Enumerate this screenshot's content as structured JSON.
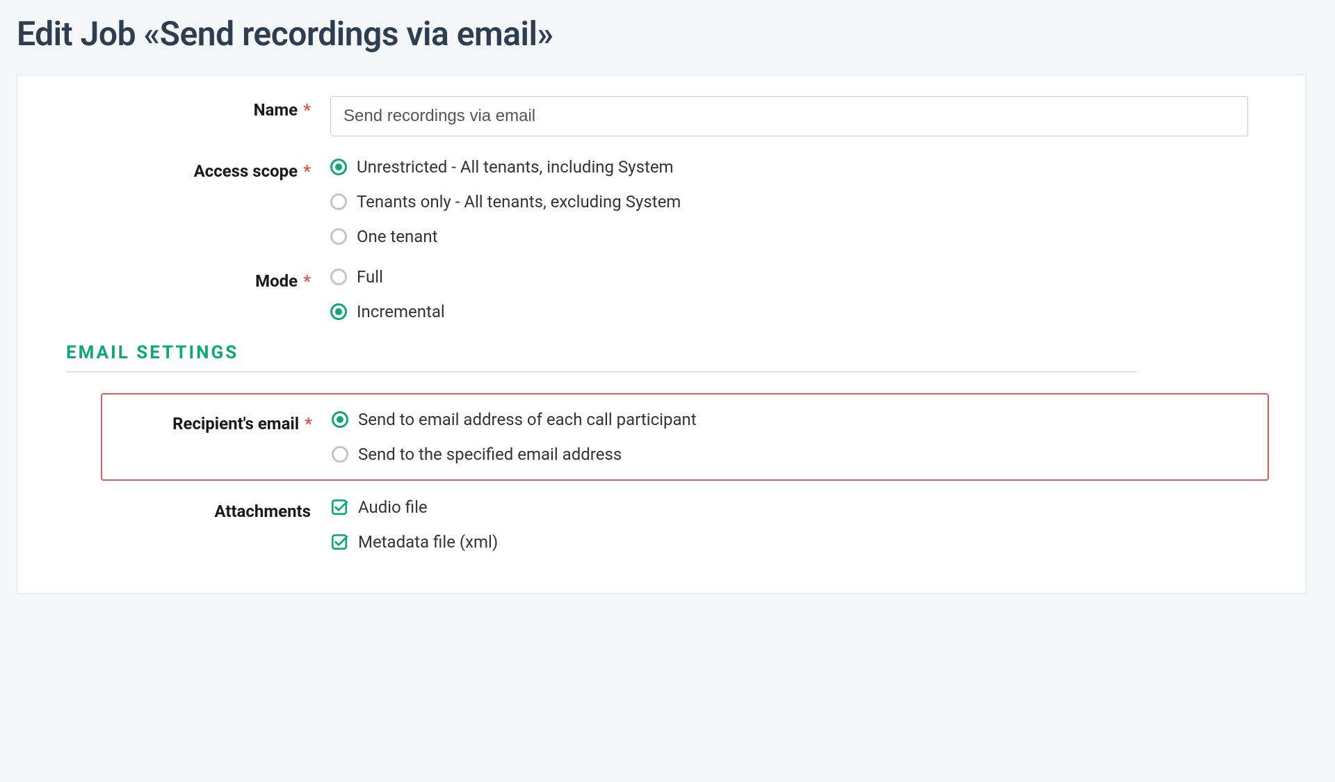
{
  "page_title": "Edit Job «Send recordings via email»",
  "form": {
    "name": {
      "label": "Name",
      "value": "Send recordings via email"
    },
    "access_scope": {
      "label": "Access scope",
      "options": [
        {
          "label": "Unrestricted - All tenants, including System",
          "selected": true
        },
        {
          "label": "Tenants only - All tenants, excluding System",
          "selected": false
        },
        {
          "label": "One tenant",
          "selected": false
        }
      ]
    },
    "mode": {
      "label": "Mode",
      "options": [
        {
          "label": "Full",
          "selected": false
        },
        {
          "label": "Incremental",
          "selected": true
        }
      ]
    }
  },
  "email_settings": {
    "heading": "EMAIL SETTINGS",
    "recipient_email": {
      "label": "Recipient's email",
      "options": [
        {
          "label": "Send to email address of each call participant",
          "selected": true
        },
        {
          "label": "Send to the specified email address",
          "selected": false
        }
      ]
    },
    "attachments": {
      "label": "Attachments",
      "options": [
        {
          "label": "Audio file",
          "checked": true
        },
        {
          "label": "Metadata file (xml)",
          "checked": true
        }
      ]
    }
  },
  "required_marker": "*"
}
